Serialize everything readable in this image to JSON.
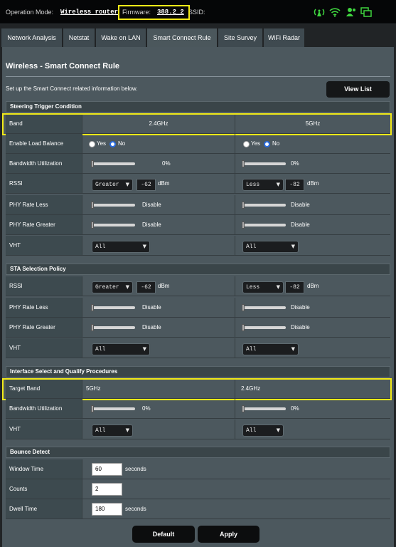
{
  "topbar": {
    "op_label": "Operation Mode:",
    "op_value": "Wireless router",
    "fw_label": "Firmware:",
    "fw_value": "388.2_2",
    "ssid_label": "SSID:",
    "icons": [
      "wifi-broadcast-icon",
      "wifi-signal-icon",
      "user-icon",
      "devices-icon"
    ],
    "icon_color": "#3fd43f"
  },
  "tabs": [
    "Network Analysis",
    "Netstat",
    "Wake on LAN",
    "Smart Connect Rule",
    "Site Survey",
    "WiFi Radar"
  ],
  "page": {
    "title": "Wireless - Smart Connect Rule",
    "description": "Set up the Smart Connect related information below.",
    "view_list": "View List"
  },
  "steering": {
    "header": "Steering Trigger Condition",
    "band": {
      "label": "Band",
      "c1": "2.4GHz",
      "c2": "5GHz"
    },
    "load_balance": {
      "label": "Enable Load Balance",
      "yes": "Yes",
      "no": "No",
      "c1": "No",
      "c2": "No"
    },
    "bw": {
      "label": "Bandwidth Utilization",
      "c1": "0%",
      "c2": "0%",
      "c1_level": 0,
      "c2_level": 0
    },
    "rssi": {
      "label": "RSSI",
      "c1_sel": "Greater",
      "c1_val": "-62",
      "c2_sel": "Less",
      "c2_val": "-82",
      "unit": "dBm"
    },
    "phy_less": {
      "label": "PHY Rate Less",
      "c1": "Disable",
      "c2": "Disable",
      "c1_level": 0,
      "c2_level": 0
    },
    "phy_greater": {
      "label": "PHY Rate Greater",
      "c1": "Disable",
      "c2": "Disable",
      "c1_level": 0,
      "c2_level": 0
    },
    "vht": {
      "label": "VHT",
      "c1": "All",
      "c2": "All"
    }
  },
  "sta": {
    "header": "STA Selection Policy",
    "rssi": {
      "label": "RSSI",
      "c1_sel": "Greater",
      "c1_val": "-62",
      "c2_sel": "Less",
      "c2_val": "-82",
      "unit": "dBm"
    },
    "phy_less": {
      "label": "PHY Rate Less",
      "c1": "Disable",
      "c2": "Disable"
    },
    "phy_greater": {
      "label": "PHY Rate Greater",
      "c1": "Disable",
      "c2": "Disable"
    },
    "vht": {
      "label": "VHT",
      "c1": "All",
      "c2": "All"
    }
  },
  "iface": {
    "header": "Interface Select and Qualify Procedures",
    "target": {
      "label": "Target Band",
      "c1": "5GHz",
      "c2": "2.4GHz"
    },
    "bw": {
      "label": "Bandwidth Utilization",
      "c1": "0%",
      "c2": "0%"
    },
    "vht": {
      "label": "VHT",
      "c1": "All",
      "c2": "All"
    }
  },
  "bounce": {
    "header": "Bounce Detect",
    "window": {
      "label": "Window Time",
      "value": "60",
      "unit": "seconds"
    },
    "counts": {
      "label": "Counts",
      "value": "2"
    },
    "dwell": {
      "label": "Dwell Time",
      "value": "180",
      "unit": "seconds"
    }
  },
  "buttons": {
    "default": "Default",
    "apply": "Apply"
  },
  "colors": {
    "highlight": "#f2ea18",
    "panel": "#4c585e",
    "radio_selected": "#2a6ce0"
  }
}
